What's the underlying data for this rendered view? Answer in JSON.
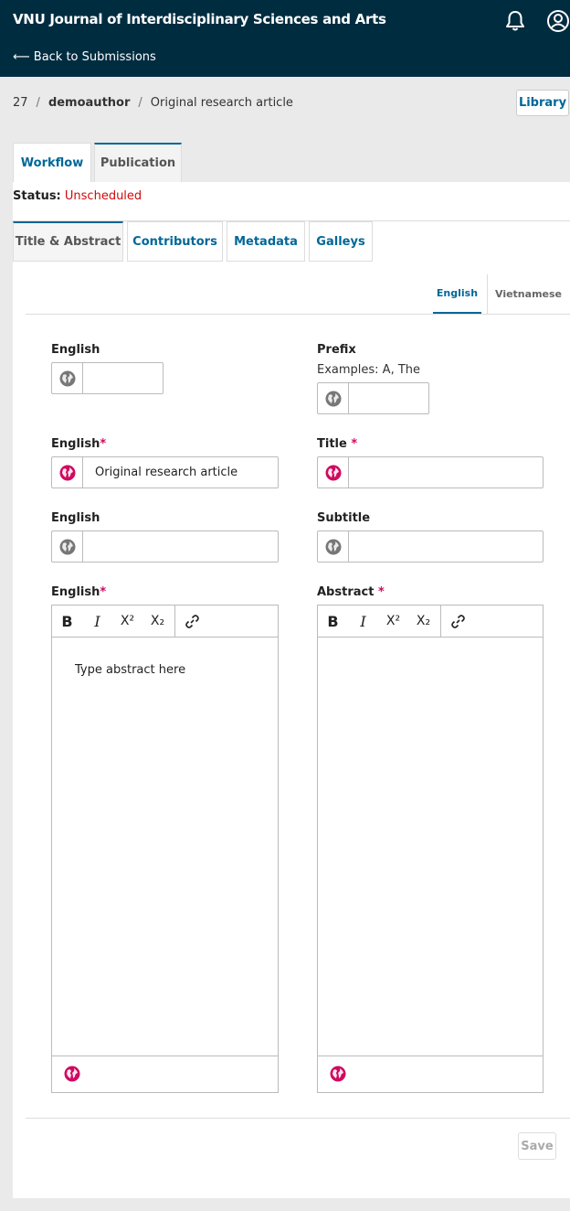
{
  "header": {
    "site_title": "VNU Journal of Interdisciplinary Sciences and Arts",
    "back_link": "⟵ Back to Submissions"
  },
  "breadcrumb": {
    "id": "27",
    "author": "demoauthor",
    "title": "Original research article"
  },
  "library_button": "Library",
  "main_tabs": [
    "Workflow",
    "Publication"
  ],
  "status": {
    "label": "Status:",
    "value": "Unscheduled"
  },
  "sub_tabs": [
    "Title & Abstract",
    "Contributors",
    "Metadata",
    "Galleys"
  ],
  "lang_tabs": [
    "English",
    "Vietnamese"
  ],
  "form": {
    "prefix_en_label": "English",
    "prefix_label": "Prefix",
    "prefix_hint": "Examples: A, The",
    "title_en_label": "English",
    "title_label": "Title",
    "title_value": "Original research article",
    "subtitle_en_label": "English",
    "subtitle_label": "Subtitle",
    "abstract_en_label": "English",
    "abstract_label": "Abstract",
    "abstract_placeholder": "Type abstract here",
    "required_mark": "*"
  },
  "toolbar": {
    "bold": "B",
    "italic": "I",
    "superscript": "X²",
    "subscript": "X₂"
  },
  "save_button": "Save",
  "colors": {
    "header_bg": "#002c40",
    "link": "#006798",
    "required": "#d00a60",
    "status": "#d00a0a",
    "globe_active": "#d00a60",
    "globe_inactive": "#777777"
  }
}
